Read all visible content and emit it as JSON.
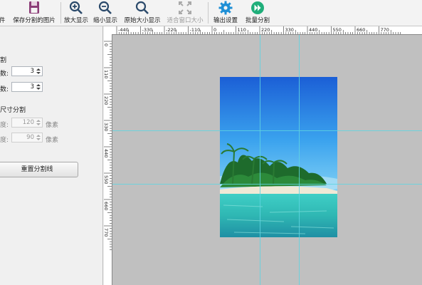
{
  "toolbar": {
    "items": [
      {
        "label": "件",
        "icon": "file-icon",
        "enabled": true
      },
      {
        "label": "保存分割的图片",
        "icon": "save-icon",
        "enabled": true
      },
      {
        "label": "放大显示",
        "icon": "zoom-in-icon",
        "enabled": true
      },
      {
        "label": "缩小显示",
        "icon": "zoom-out-icon",
        "enabled": true
      },
      {
        "label": "原始大小显示",
        "icon": "zoom-actual-icon",
        "enabled": true
      },
      {
        "label": "适合窗口大小",
        "icon": "fit-window-icon",
        "enabled": false
      },
      {
        "label": "输出设置",
        "icon": "gear-icon",
        "enabled": true
      },
      {
        "label": "批量分割",
        "icon": "batch-play-icon",
        "enabled": true
      }
    ],
    "accent": "#1e8fd6"
  },
  "panel": {
    "section1_title": "割",
    "rows_label": "数:",
    "rows_value": "3",
    "cols_label": "数:",
    "cols_value": "3",
    "section2_title": "尺寸分割",
    "width_label": "度:",
    "width_value": "120",
    "width_unit": "像素",
    "height_label": "度:",
    "height_value": "90",
    "height_unit": "像素",
    "reset_button": "重置分割线"
  },
  "ruler": {
    "top_labels": [
      "-440",
      "-330",
      "-220",
      "-110",
      "0",
      "110",
      "220",
      "330",
      "440",
      "550",
      "660",
      "770"
    ],
    "left_labels": [
      "0",
      "110",
      "220",
      "330",
      "440",
      "550",
      "660",
      "770"
    ]
  },
  "canvas": {
    "background": "#c0c0c0",
    "guide_color": "#5fd4e0",
    "split_rows": 3,
    "split_cols": 3
  }
}
